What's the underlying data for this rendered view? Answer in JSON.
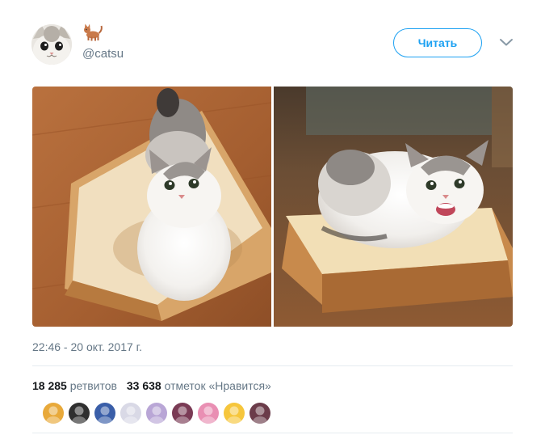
{
  "user": {
    "handle": "@catsu",
    "display_name_icon": "cat-emoji-icon",
    "avatar": "cat-face-avatar"
  },
  "follow_button": {
    "label": "Читать"
  },
  "menu": {
    "icon": "chevron-down-icon"
  },
  "media": {
    "photos": [
      "cat-on-bread-photo-1",
      "cat-on-bread-photo-2"
    ]
  },
  "timestamp": "22:46 - 20 окт. 2017 г.",
  "stats": {
    "retweets_count": "18 285",
    "retweets_label": "ретвитов",
    "likes_count": "33 638",
    "likes_label": "отметок «Нравится»"
  },
  "likers": [
    {
      "name": "liker-avatar-1",
      "color": "#e8a93a"
    },
    {
      "name": "liker-avatar-2",
      "color": "#2f2f2f"
    },
    {
      "name": "liker-avatar-3",
      "color": "#3a5ea8"
    },
    {
      "name": "liker-avatar-4",
      "color": "#d9d9e6"
    },
    {
      "name": "liker-avatar-5",
      "color": "#b9a6d6"
    },
    {
      "name": "liker-avatar-6",
      "color": "#7a3b55"
    },
    {
      "name": "liker-avatar-7",
      "color": "#e98fb3"
    },
    {
      "name": "liker-avatar-8",
      "color": "#f6c63c"
    },
    {
      "name": "liker-avatar-9",
      "color": "#6b3c4a"
    }
  ],
  "colors": {
    "accent": "#1da1f2",
    "secondary_text": "#657786",
    "divider": "#e6ecf0"
  }
}
